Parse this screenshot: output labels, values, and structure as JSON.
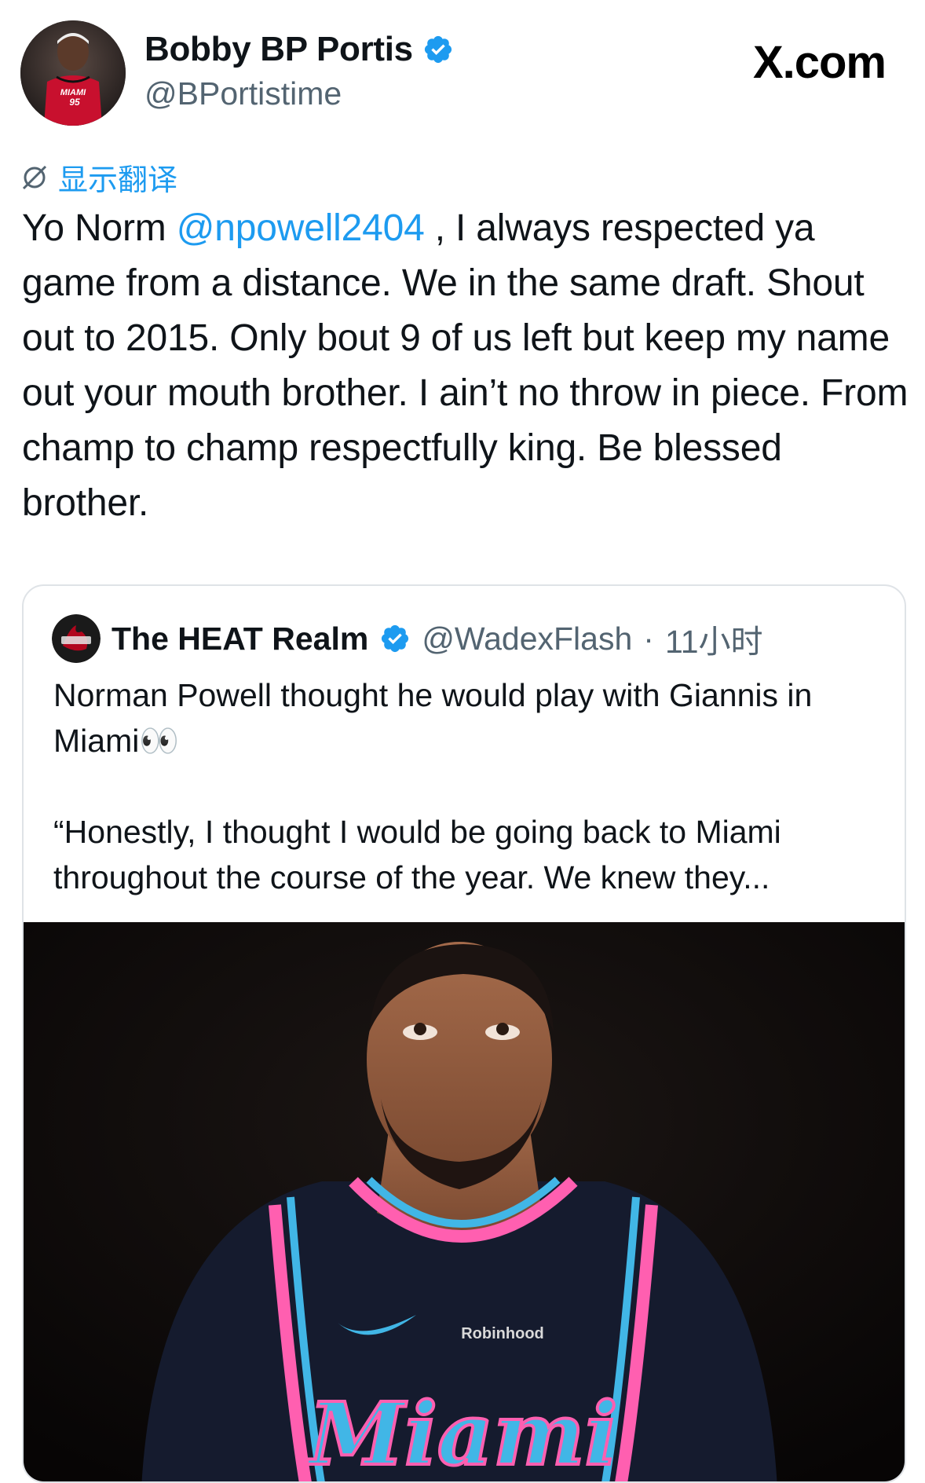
{
  "author": {
    "name": "Bobby BP Portis",
    "handle": "@BPortistime",
    "verified": true,
    "avatar_jersey_text": "MIAMI",
    "avatar_jersey_number": "95"
  },
  "site": {
    "logo_text": "X.com"
  },
  "translate": {
    "label": "显示翻译"
  },
  "tweet": {
    "text_before": "Yo Norm ",
    "mention": "@npowell2404",
    "text_after": " , I always respected ya game from a distance. We in the same draft. Shout out to 2015. Only bout 9 of us left but keep my name out your mouth brother. I ain’t no throw in piece. From champ to champ respectfully king. Be blessed brother."
  },
  "quote": {
    "name": "The HEAT Realm",
    "handle": "@WadexFlash",
    "separator": "·",
    "time": "11小时",
    "verified": true,
    "paragraph1": "Norman Powell thought he would play with Giannis in Miami👀",
    "paragraph2": "“Honestly, I thought I would be going back to Miami throughout the course of the year. We knew they...",
    "image": {
      "jersey_sponsor": "Robinhood",
      "jersey_script": "Miami"
    }
  },
  "colors": {
    "link": "#1d9bf0",
    "secondary_text": "#536471",
    "primary_text": "#0f1419",
    "heat_red": "#98002e"
  }
}
